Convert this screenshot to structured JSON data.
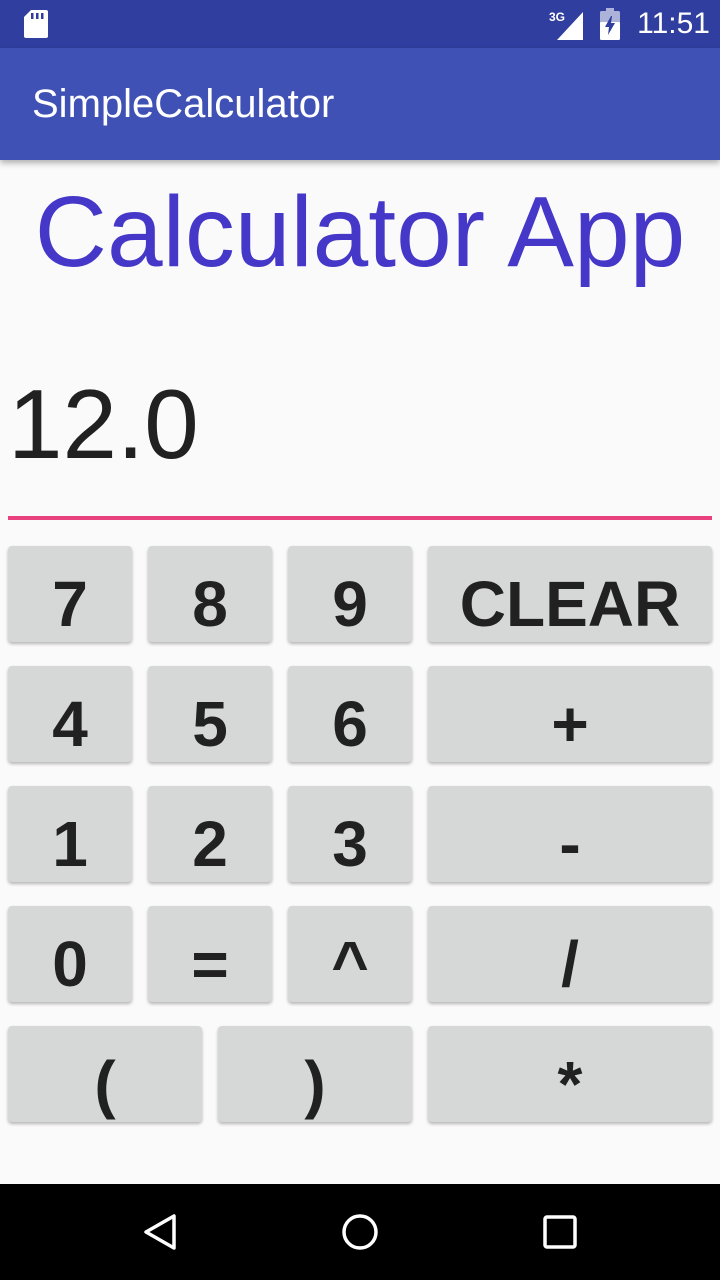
{
  "status_bar": {
    "network": "3G",
    "time": "11:51",
    "icons": [
      "sd-card-icon",
      "signal-icon",
      "battery-charging-icon"
    ]
  },
  "app_bar": {
    "title": "SimpleCalculator"
  },
  "heading": "Calculator App",
  "display": {
    "value": "12.0"
  },
  "keypad": {
    "rows": [
      [
        "7",
        "8",
        "9",
        "CLEAR"
      ],
      [
        "4",
        "5",
        "6",
        "+"
      ],
      [
        "1",
        "2",
        "3",
        "-"
      ],
      [
        "0",
        "=",
        "^",
        "/"
      ],
      [
        "(",
        ")",
        "*"
      ]
    ]
  },
  "nav_bar": {
    "icons": [
      "back-icon",
      "home-icon",
      "recent-apps-icon"
    ]
  },
  "colors": {
    "status_bar": "#303f9f",
    "app_bar": "#3f51b5",
    "heading": "#4537c8",
    "underline": "#e8417e",
    "button": "#d6d7d7",
    "background": "#fafafa"
  }
}
